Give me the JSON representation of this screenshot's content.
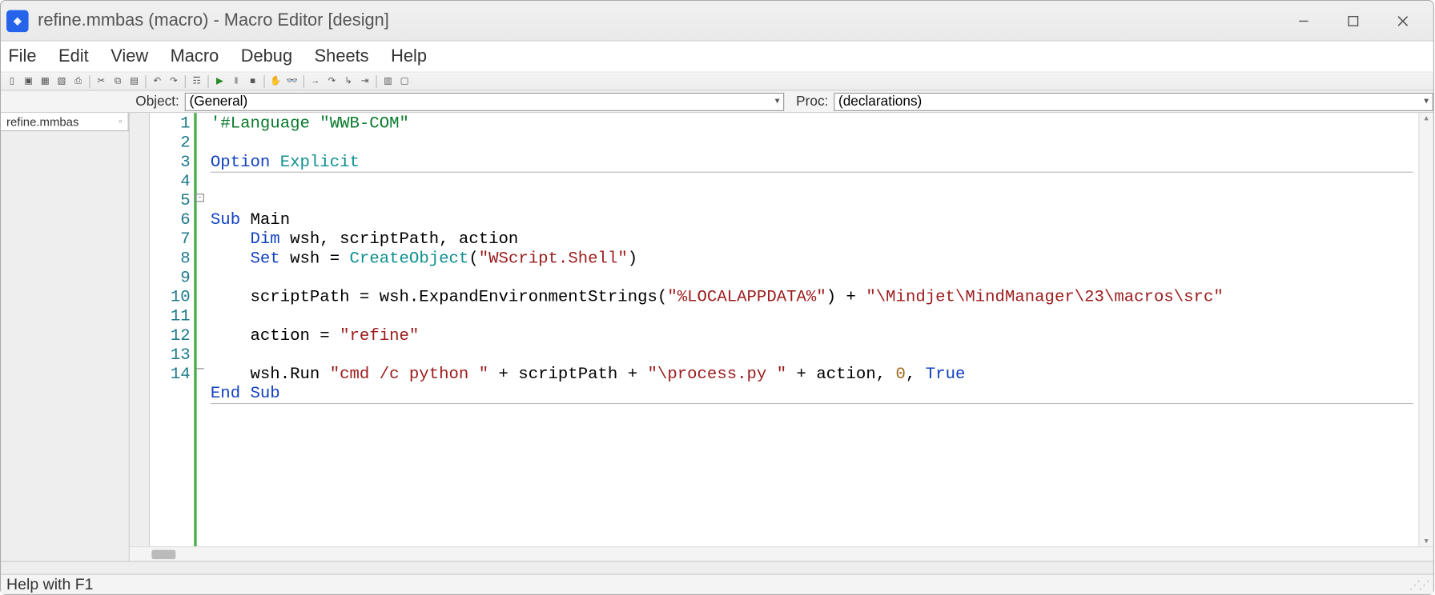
{
  "window": {
    "title": "refine.mmbas (macro) - Macro Editor [design]",
    "app_icon_text": "◈"
  },
  "menus": {
    "file": "File",
    "edit": "Edit",
    "view": "View",
    "macro": "Macro",
    "debug": "Debug",
    "sheets": "Sheets",
    "help": "Help"
  },
  "selectors": {
    "object_label": "Object:",
    "object_value": "(General)",
    "proc_label": "Proc:",
    "proc_value": "(declarations)"
  },
  "tab": {
    "filename": "refine.mmbas"
  },
  "gutter": {
    "lines": [
      "1",
      "2",
      "3",
      "4",
      "5",
      "6",
      "7",
      "8",
      "9",
      "10",
      "11",
      "12",
      "13",
      "14"
    ]
  },
  "code": {
    "l1_comment": "'#Language \"WWB-COM\"",
    "l3_option": "Option",
    "l3_explicit": "Explicit",
    "l5_sub": "Sub",
    "l5_main": " Main",
    "l6_dim": "Dim",
    "l6_rest": " wsh, scriptPath, action",
    "l7_set": "Set",
    "l7_wsh": " wsh = ",
    "l7_create": "CreateObject",
    "l7_paren1": "(",
    "l7_str": "\"WScript.Shell\"",
    "l7_paren2": ")",
    "l9_a": "    scriptPath = wsh.ExpandEnvironmentStrings(",
    "l9_s1": "\"%LOCALAPPDATA%\"",
    "l9_b": ") + ",
    "l9_s2": "\"\\Mindjet\\MindManager\\23\\macros\\src\"",
    "l11_a": "    action = ",
    "l11_s": "\"refine\"",
    "l13_a": "    wsh.Run ",
    "l13_s1": "\"cmd /c python \"",
    "l13_b": " + scriptPath + ",
    "l13_s2": "\"\\process.py \"",
    "l13_c": " + action, ",
    "l13_n": "0",
    "l13_d": ", ",
    "l13_true": "True",
    "l14_end": "End",
    "l14_sub": "Sub"
  },
  "status": {
    "text": "Help with F1"
  }
}
